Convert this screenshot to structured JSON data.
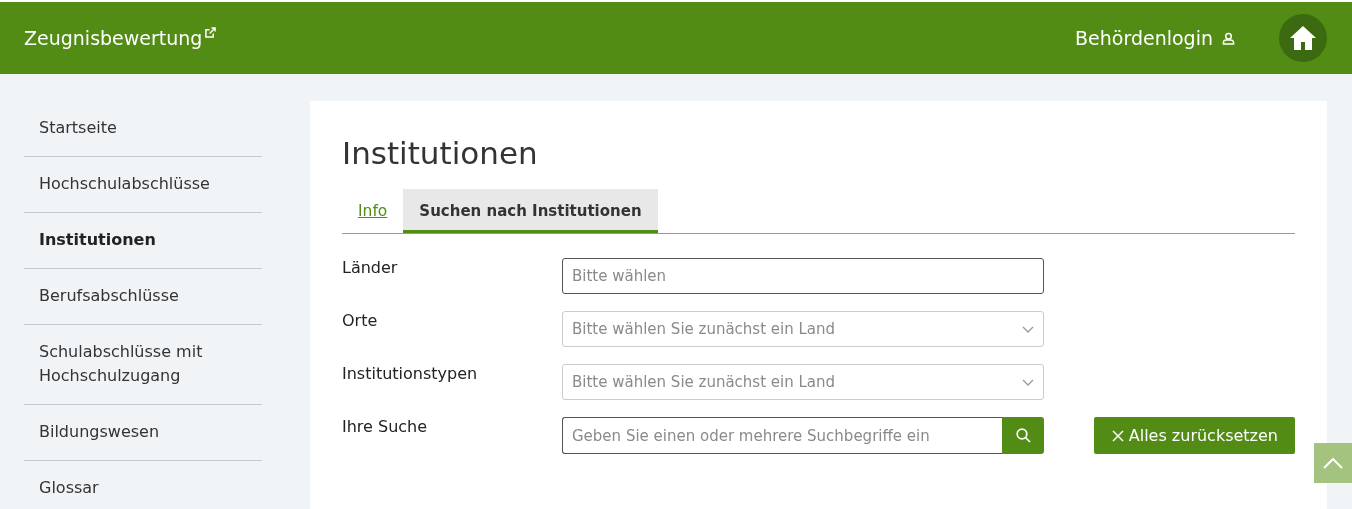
{
  "header": {
    "title": "Zeugnisbewertung",
    "login": "Behördenlogin"
  },
  "sidebar": {
    "items": [
      {
        "label": "Startseite",
        "selected": false
      },
      {
        "label": "Hochschulabschlüsse",
        "selected": false
      },
      {
        "label": "Institutionen",
        "selected": true
      },
      {
        "label": "Berufsabschlüsse",
        "selected": false
      },
      {
        "label": "Schulabschlüsse mit Hochschulzugang",
        "selected": false
      },
      {
        "label": "Bildungswesen",
        "selected": false
      },
      {
        "label": "Glossar",
        "selected": false
      }
    ]
  },
  "main": {
    "title": "Institutionen",
    "tabs": [
      {
        "label": "Info",
        "selected": false
      },
      {
        "label": "Suchen nach Institutionen",
        "selected": true
      }
    ],
    "fields": [
      {
        "label": "Länder",
        "kind": "text",
        "placeholder": "Bitte wählen",
        "disabled": false
      },
      {
        "label": "Orte",
        "kind": "select",
        "placeholder": "Bitte wählen Sie zunächst ein Land",
        "disabled": true
      },
      {
        "label": "Institutionstypen",
        "kind": "select",
        "placeholder": "Bitte wählen Sie zunächst ein Land",
        "disabled": true
      },
      {
        "label": "Ihre Suche",
        "kind": "search",
        "placeholder": "Geben Sie einen oder mehrere Suchbegriffe ein",
        "disabled": false
      }
    ],
    "reset_button": "Alles zurücksetzen"
  }
}
